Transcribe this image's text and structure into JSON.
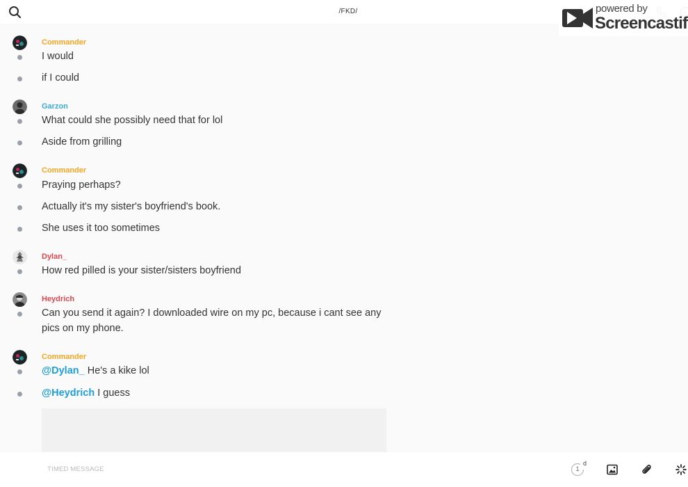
{
  "header": {
    "title": "/FKD/",
    "search_icon": "search-icon",
    "call_icon": "phone-icon",
    "info_icon": "info-icon"
  },
  "watermark": {
    "powered_by": "powered by",
    "brand": "Screencastify"
  },
  "colors": {
    "commander": "#f5a623",
    "garzon": "#3fa9d8",
    "dylan": "#e0474c",
    "heydrich": "#e0474c",
    "mention": "#1f9fd8"
  },
  "groups": [
    {
      "author": "Commander",
      "messages": [
        "I would",
        "if I could"
      ]
    },
    {
      "author": "Garzon",
      "messages": [
        "What could she possibly need that for lol",
        "Aside from grilling"
      ]
    },
    {
      "author": "Commander",
      "messages": [
        "Praying perhaps?",
        "Actually it's my sister's boyfriend's book.",
        "She uses it too sometimes"
      ]
    },
    {
      "author": "Dylan_",
      "messages": [
        "How red pilled is your sister/sisters boyfriend"
      ]
    },
    {
      "author": "Heydrich",
      "messages": [
        "Can you send it again? I downloaded wire on my pc, because i cant see any pics on my phone."
      ]
    },
    {
      "author": "Commander",
      "messages": [
        {
          "mention": "@Dylan_",
          "text": " He's a kike lol"
        },
        {
          "mention": "@Heydrich",
          "text": " I guess"
        }
      ]
    }
  ],
  "composer": {
    "placeholder": "TIMED MESSAGE",
    "timer_count": "1",
    "timer_unit": "d"
  }
}
